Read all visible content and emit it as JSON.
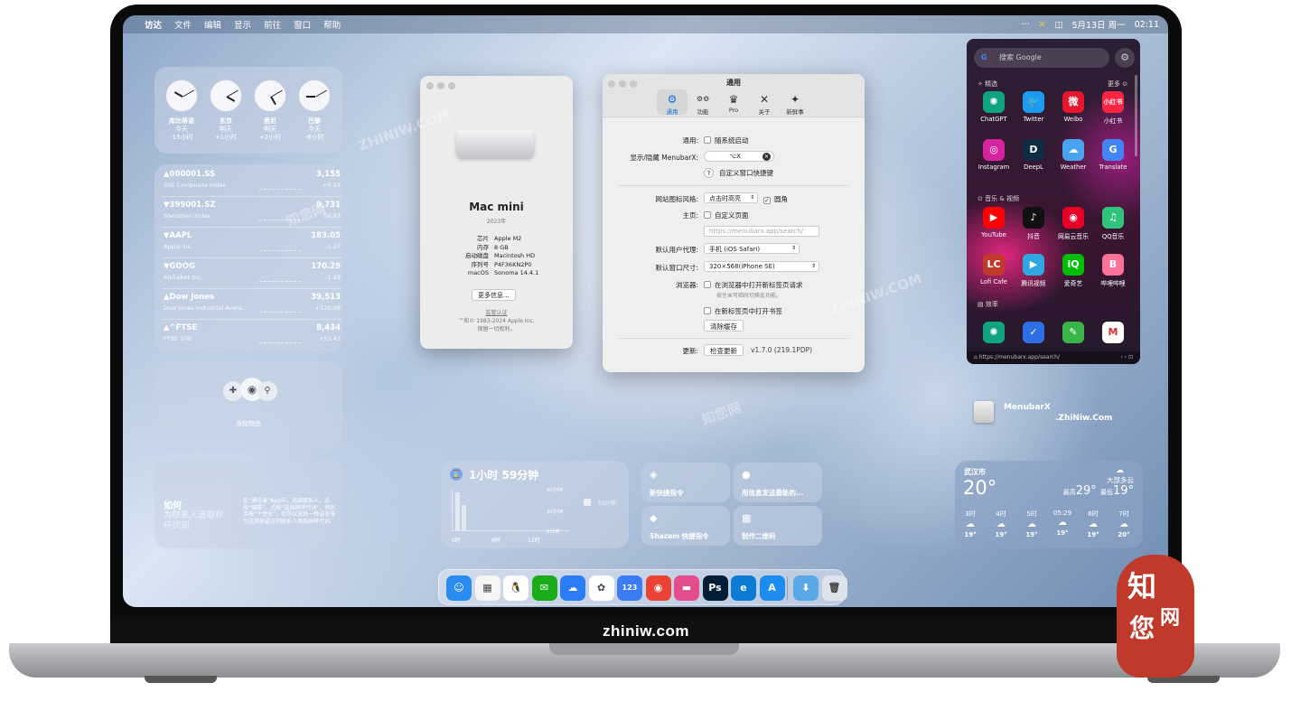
{
  "menubar": {
    "apple": "",
    "items": [
      "访达",
      "文件",
      "编辑",
      "显示",
      "前往",
      "窗口",
      "帮助"
    ],
    "right_dots": "···",
    "date": "5月13日 周一",
    "time": "02:11"
  },
  "clocks": [
    {
      "city": "库比蒂诺",
      "day": "今天",
      "offset": "-15小时"
    },
    {
      "city": "东京",
      "day": "明天",
      "offset": "+1小时"
    },
    {
      "city": "悉尼",
      "day": "明天",
      "offset": "+2小时"
    },
    {
      "city": "巴黎",
      "day": "今天",
      "offset": "-6小时"
    }
  ],
  "stocks": [
    {
      "symbol": "▲000001.SS",
      "name": "SSE Composite Index",
      "price": "3,155",
      "change": "+0.23"
    },
    {
      "symbol": "▼399001.SZ",
      "name": "Shenzhen Index",
      "price": "9,731",
      "change": "-56.83"
    },
    {
      "symbol": "▼AAPL",
      "name": "Apple Inc.",
      "price": "183.05",
      "change": "-1.27"
    },
    {
      "symbol": "▼GOOG",
      "name": "Alphabet Inc.",
      "price": "170.29",
      "change": "-1.29"
    },
    {
      "symbol": "▲Dow Jones",
      "name": "Dow Jones Industrial Avera...",
      "price": "39,513",
      "change": "+125.08"
    },
    {
      "symbol": "▲^FTSE",
      "name": "FTSE 100",
      "price": "8,434",
      "change": "+52.41"
    }
  ],
  "findmy": {
    "label": "添加物品"
  },
  "tip": {
    "title": "如何",
    "subtitle": "为联系人选取称呼代词",
    "body": "在“通讯录”App中，选择联系人，点按“编辑”，点按“选择称呼代词”，然后点按“个性化”。你可以选择一种语言来为这其他语言的联系人添加称呼代词。"
  },
  "screentime": {
    "value": "1小时 59分钟",
    "yticks": [
      "60分钟",
      "30分钟",
      "0分钟"
    ],
    "xticks": [
      "0时",
      "6时",
      "12时"
    ],
    "side": "53分钟"
  },
  "shortcuts": [
    {
      "icon": "◈",
      "label": "新快捷指令"
    },
    {
      "icon": "●",
      "label": "用信息发送最新的..."
    },
    {
      "icon": "◆",
      "label": "Shazam 快捷指令"
    },
    {
      "icon": "▦",
      "label": "制作二维码"
    }
  ],
  "about": {
    "model": "Mac mini",
    "year": "2023年",
    "rows": [
      [
        "芯片",
        "Apple M2"
      ],
      [
        "内存",
        "8 GB"
      ],
      [
        "启动磁盘",
        "Macintosh HD"
      ],
      [
        "序列号",
        "P4F36KN2P0"
      ],
      [
        "macOS",
        "Sonoma 14.4.1"
      ]
    ],
    "more_button": "更多信息...",
    "cert": "监管认证",
    "copyright": "™和© 1983-2024 Apple Inc.",
    "rights": "保留一切权利。"
  },
  "settings": {
    "title": "通用",
    "tabs": [
      "通用",
      "功能",
      "Pro",
      "关于",
      "新鲜事"
    ],
    "tab_icons": [
      "⚙",
      "⚙⚙",
      "♛",
      "✕",
      "✦"
    ],
    "startup_label": "通用:",
    "startup_text": "随系统启动",
    "hotkey_label": "显示/隐藏 MenubarX:",
    "hotkey_value": "⌥X",
    "custom_window_hotkey": "自定义窗口快捷键",
    "icon_style_label": "网站图标风格:",
    "icon_style_value": "点击时高亮",
    "rounded": "圆角",
    "home_label": "主页:",
    "custom_home": "自定义页面",
    "home_placeholder": "https://menubarx.app/search/",
    "ua_label": "默认用户代理:",
    "ua_value": "手机 (iOS Safari)",
    "size_label": "默认窗口尺寸:",
    "size_value": "320×568(iPhone SE)",
    "browser_label": "浏览器:",
    "browser_opt1": "在浏览器中打开新标签页请求",
    "browser_hint": "按住⌘可临时切换此功能。",
    "browser_opt2": "在新标签页中打开书签",
    "clear_cache": "清除缓存",
    "update_label": "更新:",
    "check_update": "检查更新",
    "version": "v1.7.0 (219.1PDP)"
  },
  "launcher": {
    "search_placeholder": "搜索 Google",
    "section_featured": "精选",
    "more": "更多",
    "section_media": "音乐 & 视频",
    "section_efficiency": "效率",
    "url": "https://menubarx.app/search/",
    "apps_row1": [
      {
        "name": "ChatGPT",
        "glyph": "✺",
        "color": "#10a37f"
      },
      {
        "name": "Twitter",
        "glyph": "🐦",
        "color": "#1d9bf0"
      },
      {
        "name": "Weibo",
        "glyph": "微",
        "color": "#e6162d"
      },
      {
        "name": "小红书",
        "glyph": "小红书",
        "color": "#ff2442"
      }
    ],
    "apps_row2": [
      {
        "name": "Instagram",
        "glyph": "◎",
        "color": "#d6249f"
      },
      {
        "name": "DeepL",
        "glyph": "D",
        "color": "#0f2b46"
      },
      {
        "name": "Weather",
        "glyph": "☁",
        "color": "#4aa3f0"
      },
      {
        "name": "Translate",
        "glyph": "G",
        "color": "#4285f4"
      }
    ],
    "apps_row3": [
      {
        "name": "YouTube",
        "glyph": "▶",
        "color": "#ff0000"
      },
      {
        "name": "抖音",
        "glyph": "♪",
        "color": "#111111"
      },
      {
        "name": "网易云音乐",
        "glyph": "◉",
        "color": "#e60026"
      },
      {
        "name": "QQ音乐",
        "glyph": "♫",
        "color": "#31c27c"
      }
    ],
    "apps_row4": [
      {
        "name": "Lofi Cafe",
        "glyph": "LC",
        "color": "#c0392b"
      },
      {
        "name": "腾讯视频",
        "glyph": "▶",
        "color": "#2fa8e1"
      },
      {
        "name": "爱奇艺",
        "glyph": "iQ",
        "color": "#00be06"
      },
      {
        "name": "哔哩哔哩",
        "glyph": "B",
        "color": "#fb7299"
      }
    ],
    "apps_row5": [
      {
        "name": "",
        "glyph": "✺",
        "color": "#10a37f"
      },
      {
        "name": "",
        "glyph": "✓",
        "color": "#2f6fe4"
      },
      {
        "name": "",
        "glyph": "✎",
        "color": "#3ab54a"
      },
      {
        "name": "",
        "glyph": "M",
        "color": "#ffffff"
      }
    ]
  },
  "desktop_icon": {
    "name": "MenubarX",
    "caption": ".ZhiNiw.Com"
  },
  "weather": {
    "city": "武汉市",
    "temp": "20°",
    "cond": "大部多云",
    "high": "29°",
    "low": "19°",
    "hours": [
      {
        "t": "3时",
        "v": "19°"
      },
      {
        "t": "4时",
        "v": "19°"
      },
      {
        "t": "5时",
        "v": "19°"
      },
      {
        "t": "05:29",
        "v": "19°"
      },
      {
        "t": "6时",
        "v": "19°"
      },
      {
        "t": "7时",
        "v": "20°"
      }
    ]
  },
  "dock": [
    {
      "name": "finder",
      "glyph": "☺",
      "color": "#2a8cf0"
    },
    {
      "name": "launchpad",
      "glyph": "▦",
      "color": "#f5f5f5"
    },
    {
      "name": "qq",
      "glyph": "🐧",
      "color": "#ffffff"
    },
    {
      "name": "wechat",
      "glyph": "✉",
      "color": "#1aad19"
    },
    {
      "name": "baidu-netdisk",
      "glyph": "☁",
      "color": "#2b7cf6"
    },
    {
      "name": "photos-cloud",
      "glyph": "✿",
      "color": "#ffffff"
    },
    {
      "name": "123pan",
      "glyph": "123",
      "color": "#3c7cf4"
    },
    {
      "name": "chrome",
      "glyph": "◉",
      "color": "#ea4335"
    },
    {
      "name": "cleanmymac",
      "glyph": "▬",
      "color": "#e54c8c"
    },
    {
      "name": "photoshop",
      "glyph": "Ps",
      "color": "#001e36"
    },
    {
      "name": "edge",
      "glyph": "e",
      "color": "#0c7bd4"
    },
    {
      "name": "app-store",
      "glyph": "A",
      "color": "#1c8cf0"
    },
    {
      "name": "downloads",
      "glyph": "⬇",
      "color": "#5aa9e6"
    },
    {
      "name": "trash",
      "glyph": "🗑",
      "color": "#dde3ea"
    }
  ],
  "site_label": "zhiniw.com",
  "seal": {
    "top": "知",
    "mid": "您",
    "side": "网"
  },
  "watermarks": [
    "ZHINIW.COM",
    "知您网",
    "ZHINIW.COM",
    "知您网"
  ]
}
